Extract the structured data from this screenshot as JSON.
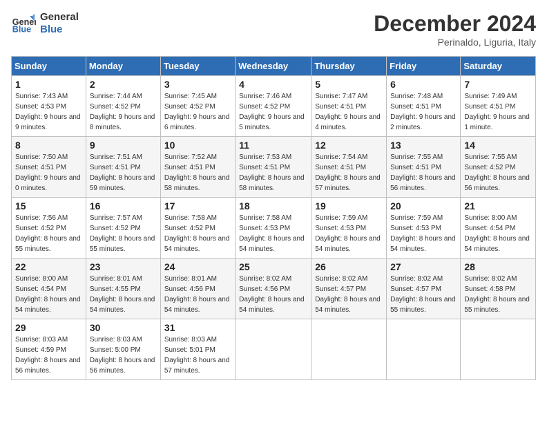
{
  "header": {
    "logo_general": "General",
    "logo_blue": "Blue",
    "month_title": "December 2024",
    "subtitle": "Perinaldo, Liguria, Italy"
  },
  "weekdays": [
    "Sunday",
    "Monday",
    "Tuesday",
    "Wednesday",
    "Thursday",
    "Friday",
    "Saturday"
  ],
  "weeks": [
    [
      {
        "day": "1",
        "sunrise": "7:43 AM",
        "sunset": "4:53 PM",
        "daylight": "9 hours and 9 minutes."
      },
      {
        "day": "2",
        "sunrise": "7:44 AM",
        "sunset": "4:52 PM",
        "daylight": "9 hours and 8 minutes."
      },
      {
        "day": "3",
        "sunrise": "7:45 AM",
        "sunset": "4:52 PM",
        "daylight": "9 hours and 6 minutes."
      },
      {
        "day": "4",
        "sunrise": "7:46 AM",
        "sunset": "4:52 PM",
        "daylight": "9 hours and 5 minutes."
      },
      {
        "day": "5",
        "sunrise": "7:47 AM",
        "sunset": "4:51 PM",
        "daylight": "9 hours and 4 minutes."
      },
      {
        "day": "6",
        "sunrise": "7:48 AM",
        "sunset": "4:51 PM",
        "daylight": "9 hours and 2 minutes."
      },
      {
        "day": "7",
        "sunrise": "7:49 AM",
        "sunset": "4:51 PM",
        "daylight": "9 hours and 1 minute."
      }
    ],
    [
      {
        "day": "8",
        "sunrise": "7:50 AM",
        "sunset": "4:51 PM",
        "daylight": "9 hours and 0 minutes."
      },
      {
        "day": "9",
        "sunrise": "7:51 AM",
        "sunset": "4:51 PM",
        "daylight": "8 hours and 59 minutes."
      },
      {
        "day": "10",
        "sunrise": "7:52 AM",
        "sunset": "4:51 PM",
        "daylight": "8 hours and 58 minutes."
      },
      {
        "day": "11",
        "sunrise": "7:53 AM",
        "sunset": "4:51 PM",
        "daylight": "8 hours and 58 minutes."
      },
      {
        "day": "12",
        "sunrise": "7:54 AM",
        "sunset": "4:51 PM",
        "daylight": "8 hours and 57 minutes."
      },
      {
        "day": "13",
        "sunrise": "7:55 AM",
        "sunset": "4:51 PM",
        "daylight": "8 hours and 56 minutes."
      },
      {
        "day": "14",
        "sunrise": "7:55 AM",
        "sunset": "4:52 PM",
        "daylight": "8 hours and 56 minutes."
      }
    ],
    [
      {
        "day": "15",
        "sunrise": "7:56 AM",
        "sunset": "4:52 PM",
        "daylight": "8 hours and 55 minutes."
      },
      {
        "day": "16",
        "sunrise": "7:57 AM",
        "sunset": "4:52 PM",
        "daylight": "8 hours and 55 minutes."
      },
      {
        "day": "17",
        "sunrise": "7:58 AM",
        "sunset": "4:52 PM",
        "daylight": "8 hours and 54 minutes."
      },
      {
        "day": "18",
        "sunrise": "7:58 AM",
        "sunset": "4:53 PM",
        "daylight": "8 hours and 54 minutes."
      },
      {
        "day": "19",
        "sunrise": "7:59 AM",
        "sunset": "4:53 PM",
        "daylight": "8 hours and 54 minutes."
      },
      {
        "day": "20",
        "sunrise": "7:59 AM",
        "sunset": "4:53 PM",
        "daylight": "8 hours and 54 minutes."
      },
      {
        "day": "21",
        "sunrise": "8:00 AM",
        "sunset": "4:54 PM",
        "daylight": "8 hours and 54 minutes."
      }
    ],
    [
      {
        "day": "22",
        "sunrise": "8:00 AM",
        "sunset": "4:54 PM",
        "daylight": "8 hours and 54 minutes."
      },
      {
        "day": "23",
        "sunrise": "8:01 AM",
        "sunset": "4:55 PM",
        "daylight": "8 hours and 54 minutes."
      },
      {
        "day": "24",
        "sunrise": "8:01 AM",
        "sunset": "4:56 PM",
        "daylight": "8 hours and 54 minutes."
      },
      {
        "day": "25",
        "sunrise": "8:02 AM",
        "sunset": "4:56 PM",
        "daylight": "8 hours and 54 minutes."
      },
      {
        "day": "26",
        "sunrise": "8:02 AM",
        "sunset": "4:57 PM",
        "daylight": "8 hours and 54 minutes."
      },
      {
        "day": "27",
        "sunrise": "8:02 AM",
        "sunset": "4:57 PM",
        "daylight": "8 hours and 55 minutes."
      },
      {
        "day": "28",
        "sunrise": "8:02 AM",
        "sunset": "4:58 PM",
        "daylight": "8 hours and 55 minutes."
      }
    ],
    [
      {
        "day": "29",
        "sunrise": "8:03 AM",
        "sunset": "4:59 PM",
        "daylight": "8 hours and 56 minutes."
      },
      {
        "day": "30",
        "sunrise": "8:03 AM",
        "sunset": "5:00 PM",
        "daylight": "8 hours and 56 minutes."
      },
      {
        "day": "31",
        "sunrise": "8:03 AM",
        "sunset": "5:01 PM",
        "daylight": "8 hours and 57 minutes."
      },
      null,
      null,
      null,
      null
    ]
  ]
}
